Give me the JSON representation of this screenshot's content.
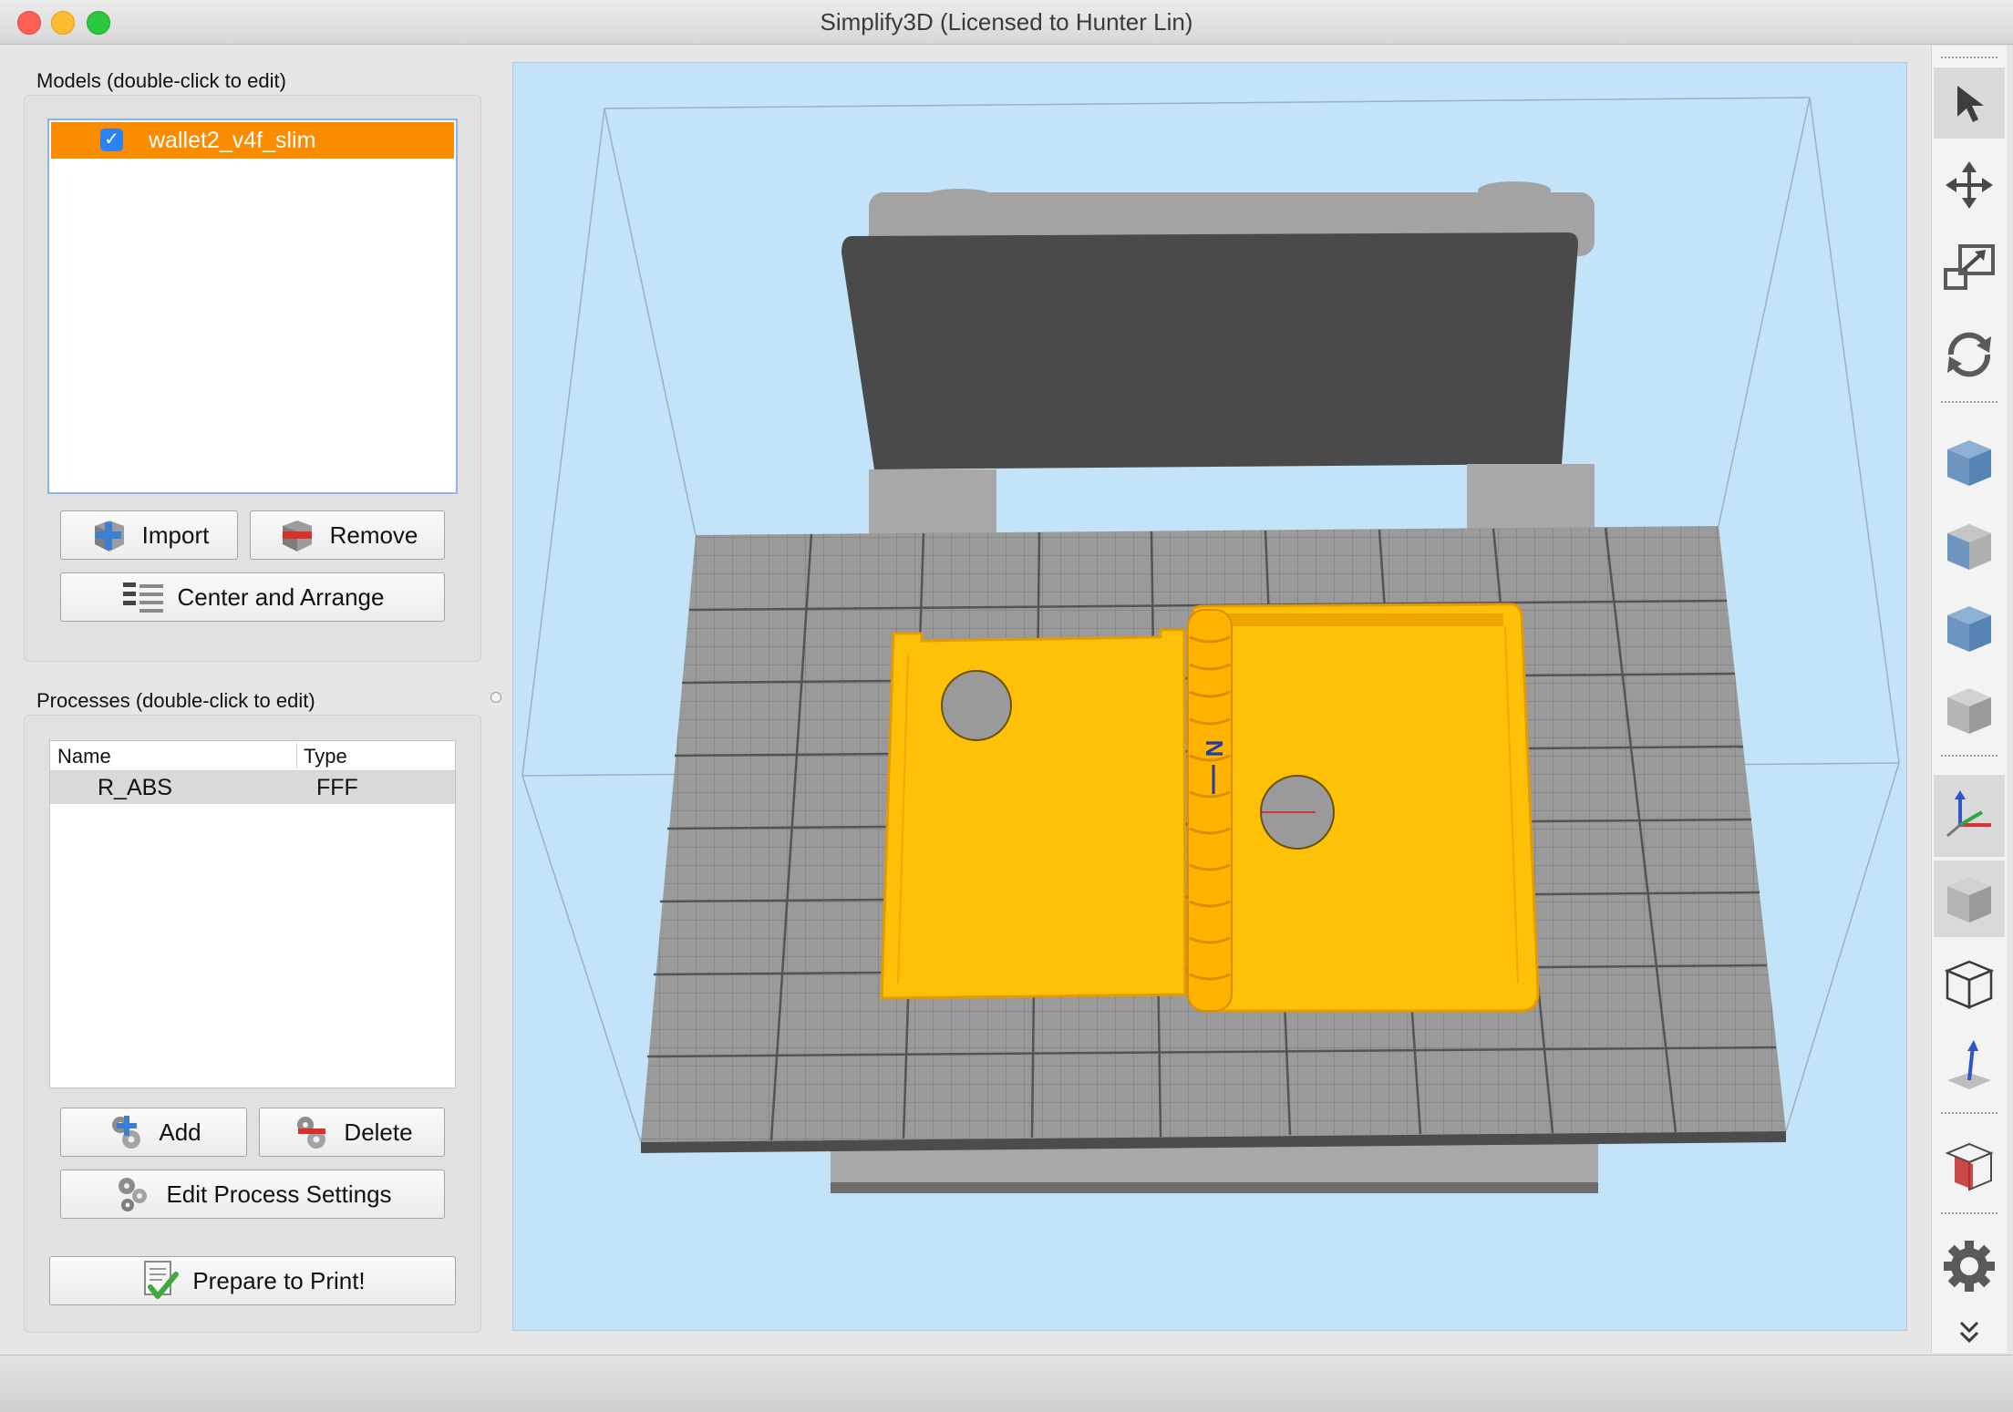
{
  "window": {
    "title": "Simplify3D (Licensed to Hunter Lin)"
  },
  "models": {
    "heading": "Models (double-click to edit)",
    "items": [
      {
        "name": "wallet2_v4f_slim",
        "checked": true,
        "selected": true
      }
    ],
    "import_label": "Import",
    "remove_label": "Remove",
    "center_arrange_label": "Center and Arrange"
  },
  "processes": {
    "heading": "Processes (double-click to edit)",
    "columns": [
      "Name",
      "Type"
    ],
    "rows": [
      {
        "name": "R_ABS",
        "type": "FFF"
      }
    ],
    "add_label": "Add",
    "delete_label": "Delete",
    "edit_label": "Edit Process Settings"
  },
  "prepare_label": "Prepare to Print!",
  "viewport": {
    "axis_marker": "N",
    "model_color": "#ffc107"
  },
  "toolbar": {
    "tools": [
      "select-icon",
      "move-icon",
      "scale-icon",
      "rotate-icon",
      "iso-view-icon",
      "front-view-icon",
      "top-view-icon",
      "side-view-icon",
      "axes-icon",
      "solid-view-icon",
      "wireframe-view-icon",
      "normal-arrow-icon",
      "cross-section-icon",
      "settings-icon",
      "expand-icon"
    ]
  }
}
